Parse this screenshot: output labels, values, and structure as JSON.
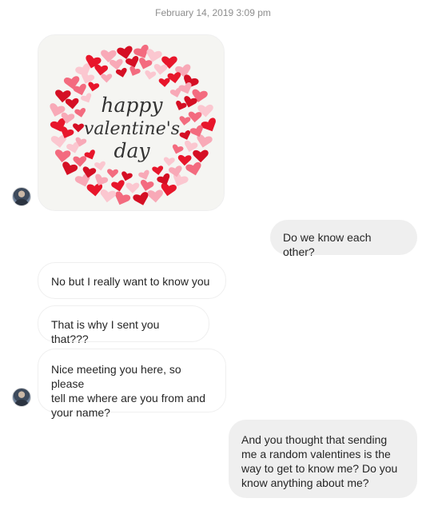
{
  "conversation": {
    "timestamp": "February 14, 2019 3:09 pm",
    "image_message": {
      "text_line1": "happy",
      "text_line2": "valentine's",
      "text_line3": "day",
      "heart_colors": [
        "#e8162b",
        "#f36b7f",
        "#f8a9b7",
        "#fbc7d0",
        "#d50f24"
      ]
    },
    "messages": [
      {
        "side": "outgoing",
        "text": "Do we know each other?"
      },
      {
        "side": "incoming",
        "text": "No but I really want to know you"
      },
      {
        "side": "incoming",
        "text": "That is why I sent you that???"
      },
      {
        "side": "incoming",
        "text": "Nice meeting you here, so please\ntell me where are you from and\nyour name?"
      },
      {
        "side": "outgoing",
        "text": "And you thought that sending\nme a random valentines is the\nway to get to know me? Do you\nknow anything about me?"
      }
    ]
  }
}
